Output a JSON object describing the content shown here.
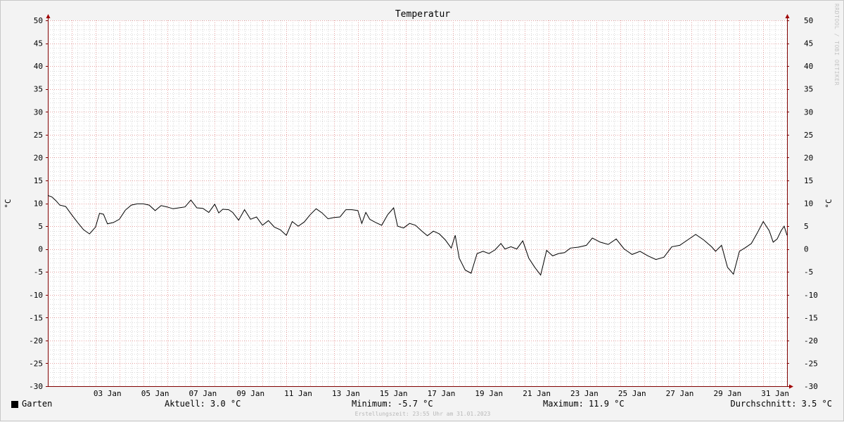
{
  "chart_data": {
    "type": "line",
    "title": "Temperatur",
    "ylabel": "°C",
    "ylabel_right": "°C",
    "ylim": [
      -30,
      50
    ],
    "yticks": [
      50,
      45,
      40,
      35,
      30,
      25,
      20,
      15,
      10,
      5,
      0,
      -5,
      -10,
      -15,
      -20,
      -25,
      -30
    ],
    "xlim": [
      "2023-01-01 00:00",
      "2023-01-31 23:55"
    ],
    "xticks": [
      {
        "label": "03 Jan",
        "date": "2023-01-03"
      },
      {
        "label": "05 Jan",
        "date": "2023-01-05"
      },
      {
        "label": "07 Jan",
        "date": "2023-01-07"
      },
      {
        "label": "09 Jan",
        "date": "2023-01-09"
      },
      {
        "label": "11 Jan",
        "date": "2023-01-11"
      },
      {
        "label": "13 Jan",
        "date": "2023-01-13"
      },
      {
        "label": "15 Jan",
        "date": "2023-01-15"
      },
      {
        "label": "17 Jan",
        "date": "2023-01-17"
      },
      {
        "label": "19 Jan",
        "date": "2023-01-19"
      },
      {
        "label": "21 Jan",
        "date": "2023-01-21"
      },
      {
        "label": "23 Jan",
        "date": "2023-01-23"
      },
      {
        "label": "25 Jan",
        "date": "2023-01-25"
      },
      {
        "label": "27 Jan",
        "date": "2023-01-27"
      },
      {
        "label": "29 Jan",
        "date": "2023-01-29"
      },
      {
        "label": "31 Jan",
        "date": "2023-01-31"
      }
    ],
    "grid": true,
    "series": [
      {
        "name": "Garten",
        "color": "#000000",
        "points": [
          [
            "2023-01-01 00:00",
            11.7
          ],
          [
            "2023-01-01 04:00",
            11.4
          ],
          [
            "2023-01-01 08:00",
            10.6
          ],
          [
            "2023-01-01 12:00",
            9.6
          ],
          [
            "2023-01-01 18:00",
            9.3
          ],
          [
            "2023-01-02 00:00",
            7.5
          ],
          [
            "2023-01-02 06:00",
            5.8
          ],
          [
            "2023-01-02 12:00",
            4.2
          ],
          [
            "2023-01-02 18:00",
            3.3
          ],
          [
            "2023-01-03 00:00",
            4.8
          ],
          [
            "2023-01-03 04:00",
            7.8
          ],
          [
            "2023-01-03 08:00",
            7.6
          ],
          [
            "2023-01-03 12:00",
            5.5
          ],
          [
            "2023-01-03 18:00",
            5.8
          ],
          [
            "2023-01-04 00:00",
            6.5
          ],
          [
            "2023-01-04 06:00",
            8.5
          ],
          [
            "2023-01-04 12:00",
            9.6
          ],
          [
            "2023-01-04 18:00",
            9.9
          ],
          [
            "2023-01-05 00:00",
            9.9
          ],
          [
            "2023-01-05 06:00",
            9.6
          ],
          [
            "2023-01-05 12:00",
            8.4
          ],
          [
            "2023-01-05 18:00",
            9.5
          ],
          [
            "2023-01-06 00:00",
            9.2
          ],
          [
            "2023-01-06 06:00",
            8.8
          ],
          [
            "2023-01-06 12:00",
            9.0
          ],
          [
            "2023-01-06 18:00",
            9.2
          ],
          [
            "2023-01-07 00:00",
            10.7
          ],
          [
            "2023-01-07 06:00",
            9.0
          ],
          [
            "2023-01-07 12:00",
            8.9
          ],
          [
            "2023-01-07 18:00",
            8.0
          ],
          [
            "2023-01-08 00:00",
            9.8
          ],
          [
            "2023-01-08 04:00",
            7.9
          ],
          [
            "2023-01-08 08:00",
            8.7
          ],
          [
            "2023-01-08 14:00",
            8.6
          ],
          [
            "2023-01-08 18:00",
            8.0
          ],
          [
            "2023-01-09 00:00",
            6.3
          ],
          [
            "2023-01-09 06:00",
            8.6
          ],
          [
            "2023-01-09 12:00",
            6.5
          ],
          [
            "2023-01-09 18:00",
            7.0
          ],
          [
            "2023-01-10 00:00",
            5.2
          ],
          [
            "2023-01-10 06:00",
            6.2
          ],
          [
            "2023-01-10 12:00",
            4.8
          ],
          [
            "2023-01-10 18:00",
            4.2
          ],
          [
            "2023-01-11 00:00",
            3.0
          ],
          [
            "2023-01-11 06:00",
            6.0
          ],
          [
            "2023-01-11 12:00",
            5.0
          ],
          [
            "2023-01-11 18:00",
            5.9
          ],
          [
            "2023-01-12 00:00",
            7.5
          ],
          [
            "2023-01-12 06:00",
            8.8
          ],
          [
            "2023-01-12 12:00",
            7.9
          ],
          [
            "2023-01-12 18:00",
            6.6
          ],
          [
            "2023-01-13 00:00",
            6.9
          ],
          [
            "2023-01-13 06:00",
            7.0
          ],
          [
            "2023-01-13 12:00",
            8.6
          ],
          [
            "2023-01-13 18:00",
            8.6
          ],
          [
            "2023-01-14 00:00",
            8.4
          ],
          [
            "2023-01-14 04:00",
            5.6
          ],
          [
            "2023-01-14 08:00",
            8.0
          ],
          [
            "2023-01-14 12:00",
            6.5
          ],
          [
            "2023-01-14 18:00",
            5.8
          ],
          [
            "2023-01-15 00:00",
            5.2
          ],
          [
            "2023-01-15 06:00",
            7.5
          ],
          [
            "2023-01-15 12:00",
            9.0
          ],
          [
            "2023-01-15 16:00",
            5.0
          ],
          [
            "2023-01-15 22:00",
            4.6
          ],
          [
            "2023-01-16 04:00",
            5.6
          ],
          [
            "2023-01-16 10:00",
            5.2
          ],
          [
            "2023-01-16 16:00",
            4.0
          ],
          [
            "2023-01-16 22:00",
            2.9
          ],
          [
            "2023-01-17 04:00",
            3.9
          ],
          [
            "2023-01-17 10:00",
            3.3
          ],
          [
            "2023-01-17 16:00",
            2.0
          ],
          [
            "2023-01-17 22:00",
            0.2
          ],
          [
            "2023-01-18 02:00",
            3.0
          ],
          [
            "2023-01-18 06:00",
            -2.0
          ],
          [
            "2023-01-18 12:00",
            -4.6
          ],
          [
            "2023-01-18 18:00",
            -5.3
          ],
          [
            "2023-01-19 00:00",
            -1.0
          ],
          [
            "2023-01-19 06:00",
            -0.5
          ],
          [
            "2023-01-19 12:00",
            -1.0
          ],
          [
            "2023-01-19 18:00",
            -0.2
          ],
          [
            "2023-01-20 00:00",
            1.2
          ],
          [
            "2023-01-20 04:00",
            0.0
          ],
          [
            "2023-01-20 10:00",
            0.5
          ],
          [
            "2023-01-20 16:00",
            0.0
          ],
          [
            "2023-01-20 22:00",
            1.8
          ],
          [
            "2023-01-21 04:00",
            -2.0
          ],
          [
            "2023-01-21 10:00",
            -4.0
          ],
          [
            "2023-01-21 16:00",
            -5.7
          ],
          [
            "2023-01-21 22:00",
            -0.3
          ],
          [
            "2023-01-22 04:00",
            -1.5
          ],
          [
            "2023-01-22 10:00",
            -1.0
          ],
          [
            "2023-01-22 16:00",
            -0.8
          ],
          [
            "2023-01-22 22:00",
            0.2
          ],
          [
            "2023-01-23 06:00",
            0.4
          ],
          [
            "2023-01-23 14:00",
            0.8
          ],
          [
            "2023-01-23 20:00",
            2.4
          ],
          [
            "2023-01-24 04:00",
            1.5
          ],
          [
            "2023-01-24 12:00",
            1.0
          ],
          [
            "2023-01-24 20:00",
            2.2
          ],
          [
            "2023-01-25 04:00",
            0.0
          ],
          [
            "2023-01-25 12:00",
            -1.2
          ],
          [
            "2023-01-25 20:00",
            -0.5
          ],
          [
            "2023-01-26 04:00",
            -1.5
          ],
          [
            "2023-01-26 12:00",
            -2.3
          ],
          [
            "2023-01-26 20:00",
            -1.8
          ],
          [
            "2023-01-27 04:00",
            0.5
          ],
          [
            "2023-01-27 12:00",
            0.8
          ],
          [
            "2023-01-27 20:00",
            2.0
          ],
          [
            "2023-01-28 04:00",
            3.2
          ],
          [
            "2023-01-28 12:00",
            2.0
          ],
          [
            "2023-01-28 20:00",
            0.5
          ],
          [
            "2023-01-29 00:00",
            -0.5
          ],
          [
            "2023-01-29 06:00",
            0.8
          ],
          [
            "2023-01-29 12:00",
            -4.0
          ],
          [
            "2023-01-29 18:00",
            -5.5
          ],
          [
            "2023-01-30 00:00",
            -0.5
          ],
          [
            "2023-01-30 06:00",
            0.3
          ],
          [
            "2023-01-30 12:00",
            1.2
          ],
          [
            "2023-01-30 18:00",
            3.5
          ],
          [
            "2023-01-31 00:00",
            6.0
          ],
          [
            "2023-01-31 06:00",
            4.0
          ],
          [
            "2023-01-31 10:00",
            1.5
          ],
          [
            "2023-01-31 14:00",
            2.2
          ],
          [
            "2023-01-31 18:00",
            4.0
          ],
          [
            "2023-01-31 21:00",
            5.0
          ],
          [
            "2023-01-31 23:55",
            3.0
          ]
        ]
      }
    ]
  },
  "legend": {
    "label": "Garten",
    "color": "#000000",
    "aktuell": "Aktuell: 3.0 °C",
    "minimum": "Minimum: -5.7 °C",
    "maximum": "Maximum: 11.9 °C",
    "durchschnitt": "Durchschnitt: 3.5 °C"
  },
  "footer": {
    "created": "Erstellungszeit: 23:55 Uhr am 31.01.2023"
  },
  "watermark": "RRDTOOL / TOBI OETIKER"
}
